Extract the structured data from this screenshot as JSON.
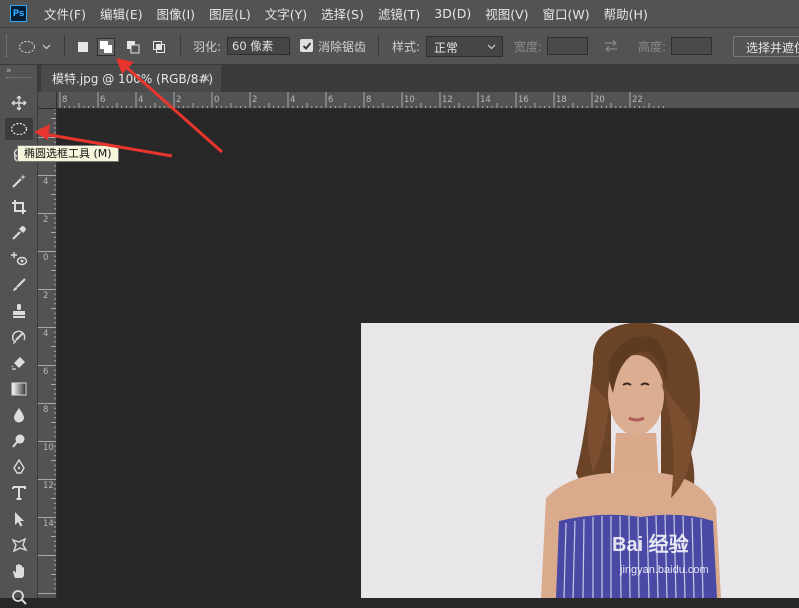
{
  "app": {
    "logo_text": "Ps"
  },
  "menu": [
    "文件(F)",
    "编辑(E)",
    "图像(I)",
    "图层(L)",
    "文字(Y)",
    "选择(S)",
    "滤镜(T)",
    "3D(D)",
    "视图(V)",
    "窗口(W)",
    "帮助(H)"
  ],
  "options_bar": {
    "feather_label": "羽化:",
    "feather_value": "60 像素",
    "antialias_label": "消除锯齿",
    "antialias_checked": true,
    "style_label": "样式:",
    "style_value": "正常",
    "width_label": "宽度:",
    "height_label": "高度:",
    "select_mask_label": "选择并遮住...",
    "active_mode": "add-to-selection"
  },
  "toolbar": {
    "active_tool": "elliptical-marquee",
    "tooltip": "椭圆选框工具 (M)"
  },
  "document": {
    "tab_title": "模特.jpg @ 100% (RGB/8#)",
    "close_glyph": "×"
  },
  "rulers": {
    "h_labels": [
      "8",
      "6",
      "4",
      "2",
      "0",
      "2",
      "4",
      "6",
      "8",
      "10",
      "12",
      "14",
      "16",
      "18",
      "20",
      "22"
    ],
    "v_labels": [
      "4",
      "2",
      "0",
      "2",
      "4",
      "6",
      "8",
      "10",
      "12",
      "14"
    ]
  },
  "watermark": {
    "main": "Bai 经验",
    "sub": "jingyan.baidu.com"
  },
  "colors": {
    "ui_panel": "#535353",
    "canvas_bg": "#282828",
    "annotation_arrow": "#e8352e"
  }
}
